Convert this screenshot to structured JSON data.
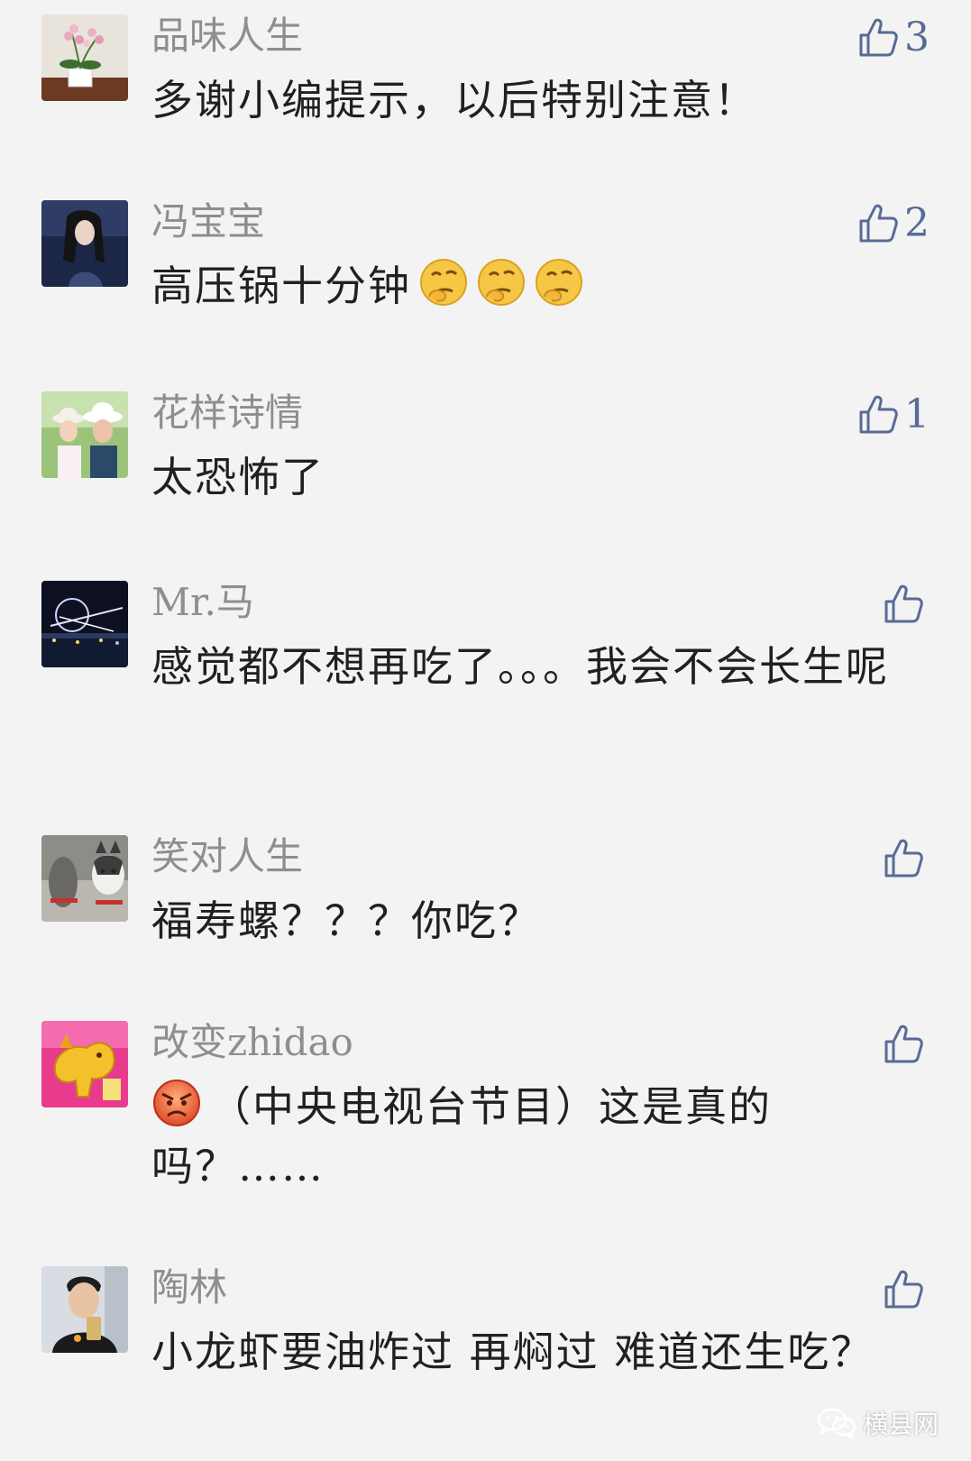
{
  "comments": [
    {
      "name": "品味人生",
      "text": "多谢小编提示，以后特别注意！",
      "likes": "3",
      "emojis": []
    },
    {
      "name": "冯宝宝",
      "text": "高压锅十分钟",
      "likes": "2",
      "emojis": [
        "thinking-emoji",
        "thinking-emoji",
        "thinking-emoji"
      ]
    },
    {
      "name": "花样诗情",
      "text": "太恐怖了",
      "likes": "1",
      "emojis": []
    },
    {
      "name": "Mr.马",
      "text": "感觉都不想再吃了。。。我会不会长生呢",
      "likes": "",
      "emojis": []
    },
    {
      "name": "笑对人生",
      "text": "福寿螺？？？你吃？",
      "likes": "",
      "emojis": []
    },
    {
      "name": "改变zhidao",
      "text": "（中央电视台节目）这是真的吗？……",
      "likes": "",
      "emojis": [
        "angry-face-emoji"
      ]
    },
    {
      "name": "陶林",
      "text": "小龙虾要油炸过 再焖过  难道还生吃？",
      "likes": "",
      "emojis": []
    }
  ],
  "watermark": {
    "text": "横县网",
    "icon": "wechat-icon"
  },
  "colors": {
    "background": "#f3f3f3",
    "name": "#8e8e8e",
    "text": "#202020",
    "like_accent": "#576b95"
  }
}
